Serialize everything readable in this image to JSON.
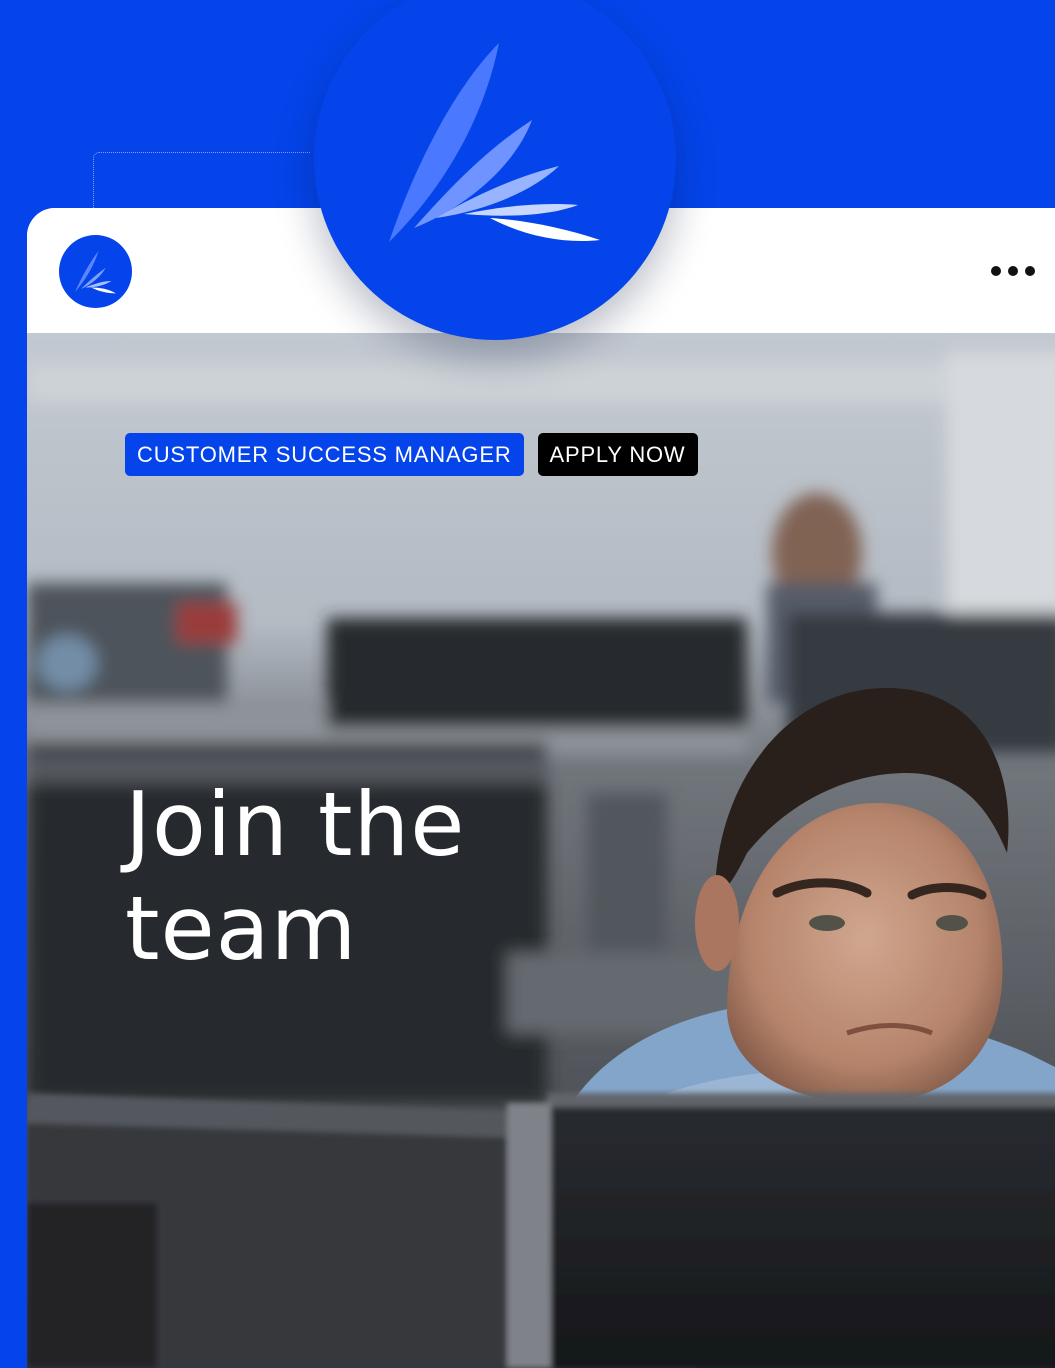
{
  "brand": {
    "color": "#0444ea",
    "logo_icon": "wing-feather-icon"
  },
  "header": {
    "menu_icon": "more-horizontal-icon"
  },
  "hero": {
    "tags": {
      "role": "CUSTOMER SUCCESS MANAGER",
      "apply": "APPLY NOW"
    },
    "headline_line1": "Join the",
    "headline_line2": "team"
  }
}
